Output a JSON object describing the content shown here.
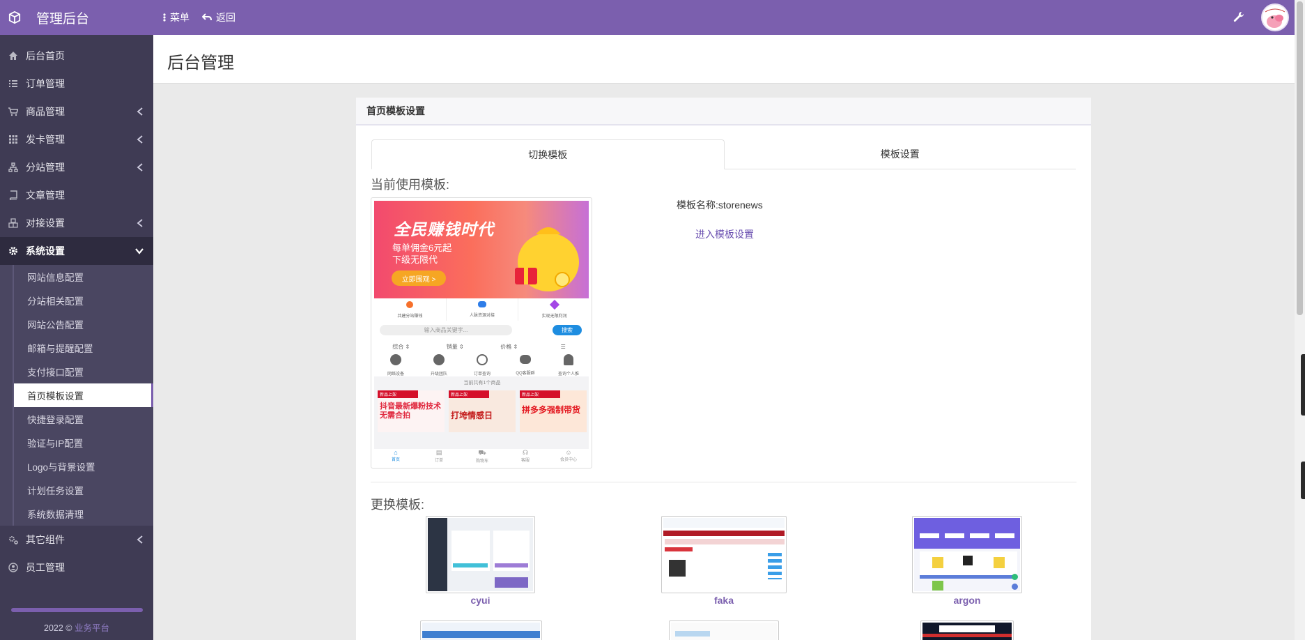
{
  "topbar": {
    "brand": "管理后台",
    "menu_label": "菜单",
    "back_label": "返回"
  },
  "sidebar": {
    "items": [
      {
        "label": "后台首页",
        "icon": "home-icon"
      },
      {
        "label": "订单管理",
        "icon": "list-icon"
      },
      {
        "label": "商品管理",
        "icon": "cart-icon"
      },
      {
        "label": "发卡管理",
        "icon": "grid-icon"
      },
      {
        "label": "分站管理",
        "icon": "sitemap-icon"
      },
      {
        "label": "文章管理",
        "icon": "book-icon"
      },
      {
        "label": "对接设置",
        "icon": "cubes-icon"
      },
      {
        "label": "系统设置",
        "icon": "gear-icon"
      }
    ],
    "sub_items": [
      "网站信息配置",
      "分站相关配置",
      "网站公告配置",
      "邮箱与提醒配置",
      "支付接口配置",
      "首页模板设置",
      "快捷登录配置",
      "验证与IP配置",
      "Logo与背景设置",
      "计划任务设置",
      "系统数据清理"
    ],
    "bottom_items": [
      {
        "label": "其它组件",
        "icon": "cogs-icon"
      },
      {
        "label": "员工管理",
        "icon": "user-circle-icon"
      }
    ],
    "footer_prefix": "2022 © ",
    "footer_link": "业务平台"
  },
  "page": {
    "title": "后台管理"
  },
  "card": {
    "title": "首页模板设置",
    "tabs": [
      "切换模板",
      "模板设置"
    ],
    "current_title": "当前使用模板:",
    "template_name": "模板名称:storenews",
    "enter_settings": "进入模板设置",
    "change_title": "更换模板:",
    "templates": [
      "cyui",
      "faka",
      "argon"
    ]
  },
  "preview": {
    "banner_main": "全民赚钱时代",
    "banner_line1": "每单佣金6元起",
    "banner_line2": "下级无限代",
    "banner_button": "立即围观 >",
    "features": [
      "共建分站赚钱",
      "人脉资源对接",
      "实现无限利润"
    ],
    "search_placeholder": "输入商品关键字...",
    "search_button": "搜索",
    "sorts": [
      "综合 ⇕",
      "销量 ⇕",
      "价格 ⇕"
    ],
    "quick": [
      "网络设备",
      "升级团队",
      "订单查询",
      "QQ客服群",
      "查询个人推"
    ],
    "count_text": "当前共有1个商品",
    "products": [
      "抖音最新爆粉技术 无需合拍",
      "打垮情感日",
      "拼多多强制带货"
    ],
    "product_tag": "新品上架",
    "nav": [
      "首页",
      "订单",
      "购物车",
      "客服",
      "会员中心"
    ]
  },
  "colors": {
    "primary": "#7b5fae",
    "sidebar": "#3f3b54",
    "sidebar_active": "#2e2b3f"
  }
}
